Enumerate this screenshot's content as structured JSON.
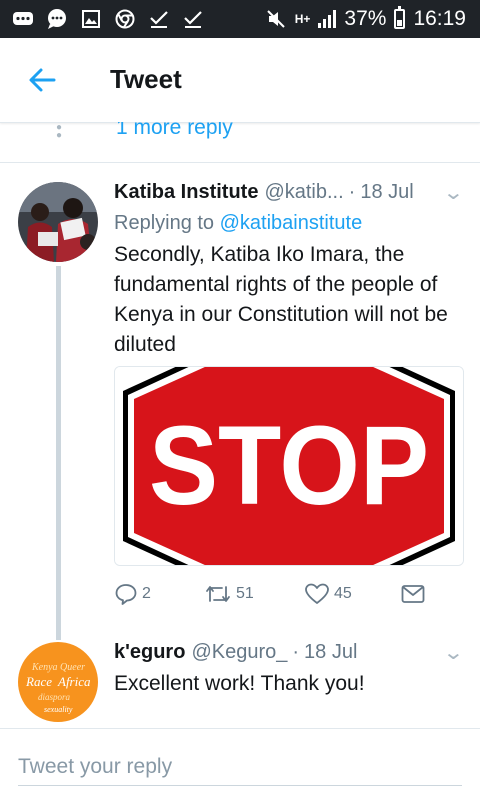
{
  "status_bar": {
    "battery": "37%",
    "time": "16:19",
    "network": "H+",
    "icons": [
      "message-icon",
      "chat-icon",
      "gallery-icon",
      "chrome-icon",
      "check-icon",
      "check-icon",
      "mute-icon",
      "network-icon",
      "signal-icon",
      "battery-icon"
    ]
  },
  "header": {
    "back_icon": "arrow-left-icon",
    "title": "Tweet"
  },
  "thread": {
    "more_replies": "1 more reply"
  },
  "tweets": [
    {
      "name": "Katiba Institute",
      "handle": "@katib...",
      "date": "18 Jul",
      "replying_prefix": "Replying to",
      "replying_handle": "@katibainstitute",
      "text": "Secondly, Katiba Iko Imara, the fundamental rights of the people of Kenya in our Constitution will not be diluted",
      "media_text": "STOP",
      "actions": {
        "replies": "2",
        "retweets": "51",
        "likes": "45"
      },
      "colors": {
        "stop_red": "#d7141a"
      }
    },
    {
      "name": "k'eguro",
      "handle": "@Keguro_",
      "date": "18 Jul",
      "text": "Excellent work! Thank you!"
    }
  ],
  "reply_box": {
    "placeholder": "Tweet your reply"
  },
  "colors": {
    "accent": "#1da1f2",
    "status_bar": "#1f2328",
    "muted": "#657786"
  }
}
